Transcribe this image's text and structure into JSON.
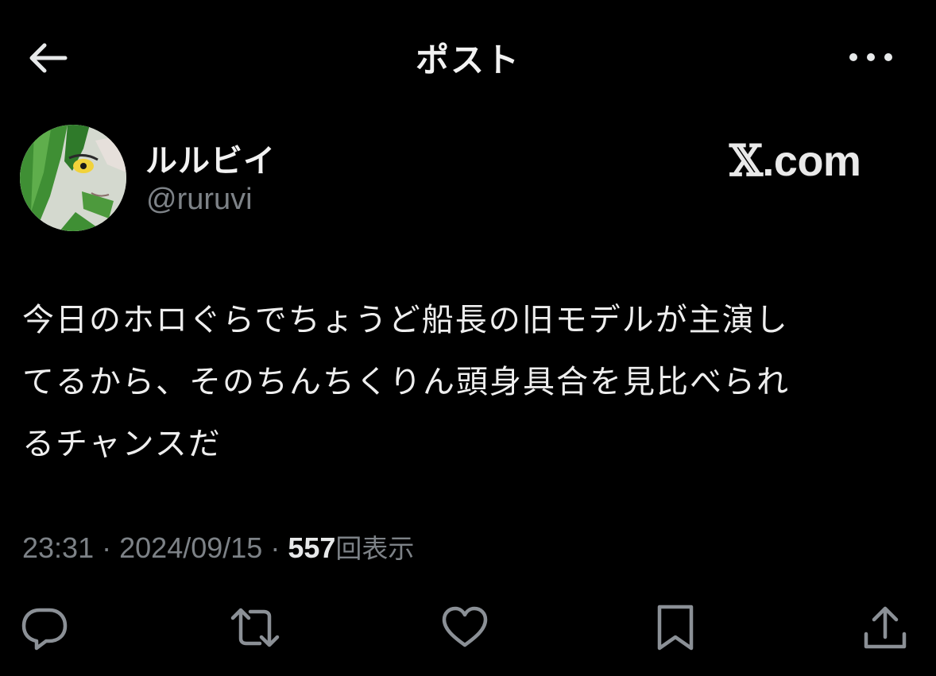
{
  "header": {
    "title": "ポスト"
  },
  "author": {
    "display_name": "ルルビイ",
    "handle": "@ruruvi"
  },
  "brand": {
    "x_glyph": "𝕏",
    "domain": ".com"
  },
  "post": {
    "lines": [
      "今日のホロぐらでちょうど船長の旧モデルが主演し",
      "てるから、そのちんちくりん頭身具合を見比べられ",
      "るチャンスだ"
    ]
  },
  "meta": {
    "time": "23:31",
    "separator": "·",
    "date": "2024/09/15",
    "views_count": "557",
    "views_label": "回表示"
  },
  "actions": [
    "reply-icon",
    "repost-icon",
    "like-icon",
    "bookmark-icon",
    "share-icon"
  ],
  "colors": {
    "background": "#000000",
    "text": "#e7e9ea",
    "muted": "#7d8287",
    "icon": "#8b9096"
  }
}
